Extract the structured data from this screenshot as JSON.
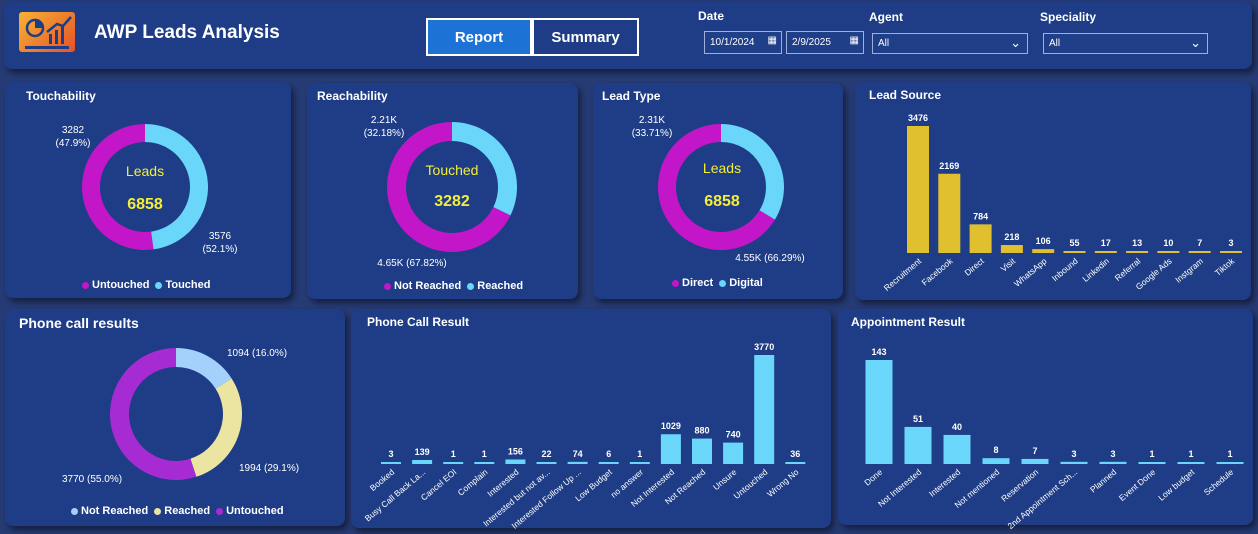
{
  "header": {
    "title": "AWP Leads Analysis",
    "tabs": [
      {
        "label": "Report"
      },
      {
        "label": "Summary"
      }
    ],
    "filters": {
      "date_label": "Date",
      "date_from": "10/1/2024",
      "date_to": "2/9/2025",
      "agent_label": "Agent",
      "agent_value": "All",
      "speciality_label": "Speciality",
      "speciality_value": "All"
    }
  },
  "colors": {
    "background": "#263a74",
    "card": "#1e3d86",
    "magenta": "#c316c9",
    "light_blue": "#69d6fa",
    "yellow_bar": "#e0c02f",
    "purple": "#a62bd3",
    "khaki": "#ece5a2",
    "pale_blue": "#a3d1fb",
    "center_text": "#f4ee36"
  },
  "touchability": {
    "title": "Touchability",
    "center_label": "Leads",
    "center_value": "6858",
    "label_touched": "3282\n(47.9%)",
    "label_untouched": "3576\n(52.1%)",
    "legend": [
      "Untouched",
      "Touched"
    ]
  },
  "reachability": {
    "title": "Reachability",
    "center_label": "Touched",
    "center_value": "3282",
    "label_reached": "2.21K\n(32.18%)",
    "label_not_reached": "4.65K (67.82%)",
    "legend": [
      "Not Reached",
      "Reached"
    ]
  },
  "lead_type": {
    "title": "Lead Type",
    "center_label": "Leads",
    "center_value": "6858",
    "label_digital": "2.31K\n(33.71%)",
    "label_direct": "4.55K (66.29%)",
    "legend": [
      "Direct",
      "Digital"
    ]
  },
  "phone_call_results": {
    "title": "Phone call results",
    "label_not_reached": "1094 (16.0%)",
    "label_reached": "1994 (29.1%)",
    "label_untouched": "3770 (55.0%)",
    "legend": [
      "Not Reached",
      "Reached",
      "Untouched"
    ]
  },
  "chart_data": [
    {
      "type": "pie",
      "title": "Touchability",
      "categories": [
        "Touched",
        "Untouched"
      ],
      "values": [
        3282,
        3576
      ]
    },
    {
      "type": "pie",
      "title": "Reachability",
      "categories": [
        "Reached",
        "Not Reached"
      ],
      "values": [
        2210,
        4650
      ]
    },
    {
      "type": "pie",
      "title": "Lead Type",
      "categories": [
        "Digital",
        "Direct"
      ],
      "values": [
        2310,
        4550
      ]
    },
    {
      "type": "bar",
      "title": "Lead Source",
      "categories": [
        "Recruitment",
        "Facebook",
        "Direct",
        "Visit",
        "WhatsApp",
        "Inbound",
        "Linkedin",
        "Referral",
        "Google Ads",
        "Instgram",
        "Tiktok"
      ],
      "values": [
        3476,
        2169,
        784,
        218,
        106,
        55,
        17,
        13,
        10,
        7,
        3
      ]
    },
    {
      "type": "pie",
      "title": "Phone call results",
      "categories": [
        "Not Reached",
        "Reached",
        "Untouched"
      ],
      "values": [
        1094,
        1994,
        3770
      ]
    },
    {
      "type": "bar",
      "title": "Phone Call Result",
      "categories": [
        "Booked",
        "Busy Call Back La...",
        "Cancel EOI",
        "Complain",
        "Interested",
        "Interested but not av...",
        "Interested Follow Up ...",
        "Low Budget",
        "no answer",
        "Not Interested",
        "Not Reached",
        "Unsure",
        "Untouched",
        "Wrong No"
      ],
      "values": [
        3,
        139,
        1,
        1,
        156,
        22,
        74,
        6,
        1,
        1029,
        880,
        740,
        3770,
        36
      ]
    },
    {
      "type": "bar",
      "title": "Appointment Result",
      "categories": [
        "Done",
        "Not Interested",
        "Interested",
        "Not mentioned",
        "Reservation",
        "2nd Appointment Sch...",
        "Planned",
        "Event Done",
        "Low budget",
        "Schedule"
      ],
      "values": [
        143,
        51,
        40,
        8,
        7,
        3,
        3,
        1,
        1,
        1
      ]
    }
  ]
}
